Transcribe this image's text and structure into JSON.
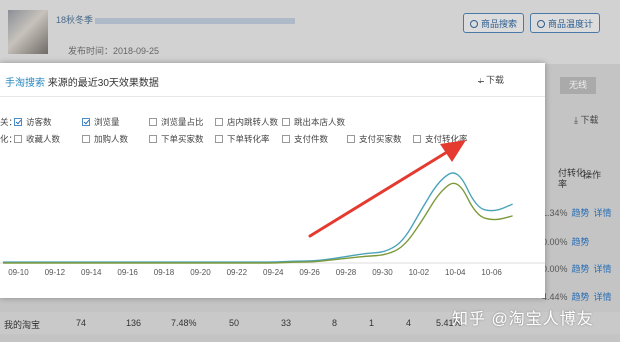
{
  "page": {
    "item_title": "18秋冬季",
    "publish_label": "发布时间：2018-09-25",
    "buttons": {
      "product_search": "商品搜索",
      "product_warmup": "商品温度计"
    },
    "wireless": "无线",
    "download": "下载",
    "table_header_right": "付转化\n率",
    "table_header_op": "操作",
    "rows": [
      {
        "value": "1.34%",
        "trend": "趋势",
        "detail": "详情"
      },
      {
        "value": "0.00%",
        "trend": "趋势",
        "detail": ""
      },
      {
        "value": "0.00%",
        "trend": "趋势",
        "detail": "详情"
      },
      {
        "value": "4.44%",
        "trend": "趋势",
        "detail": "详情"
      }
    ],
    "bottom_row": [
      "我的淘宝",
      "74",
      "136",
      "7.48%",
      "50",
      "33",
      "8",
      "1",
      "4",
      "5.41%"
    ],
    "watermark": "知乎 @淘宝人博友"
  },
  "modal": {
    "title_prefix": "手淘搜索",
    "title_rest": "来源的最近30天效果数据",
    "download": "下载",
    "metrics_row1_label": "关：",
    "metrics_row1": [
      {
        "label": "访客数",
        "checked": true
      },
      {
        "label": "浏览量",
        "checked": true
      },
      {
        "label": "浏览量占比",
        "checked": false
      },
      {
        "label": "店内跳转人数",
        "checked": false
      },
      {
        "label": "跳出本店人数",
        "checked": false
      }
    ],
    "metrics_row2_label": "化：",
    "metrics_row2": [
      {
        "label": "收藏人数",
        "checked": false
      },
      {
        "label": "加购人数",
        "checked": false
      },
      {
        "label": "下单买家数",
        "checked": false
      },
      {
        "label": "下单转化率",
        "checked": false
      },
      {
        "label": "支付件数",
        "checked": false
      },
      {
        "label": "支付买家数",
        "checked": false
      },
      {
        "label": "支付转化率",
        "checked": false
      }
    ]
  },
  "chart_data": {
    "type": "line",
    "x": [
      "09-09",
      "09-10",
      "09-11",
      "09-12",
      "09-13",
      "09-14",
      "09-15",
      "09-16",
      "09-17",
      "09-18",
      "09-19",
      "09-20",
      "09-21",
      "09-22",
      "09-23",
      "09-24",
      "09-25",
      "09-26",
      "09-27",
      "09-28",
      "09-29",
      "09-30",
      "10-01",
      "10-02",
      "10-03",
      "10-04",
      "10-05",
      "10-06",
      "10-07"
    ],
    "xticks": [
      "09-10",
      "09-12",
      "09-14",
      "09-16",
      "09-18",
      "09-20",
      "09-22",
      "09-24",
      "09-26",
      "09-28",
      "09-30",
      "10-02",
      "10-04",
      "10-06"
    ],
    "series": [
      {
        "color": "#4aa3b8",
        "values": [
          1,
          1,
          1,
          1,
          1,
          1,
          1,
          1,
          1,
          1,
          1,
          1,
          1,
          1,
          1,
          1,
          2,
          2,
          4,
          7,
          10,
          11,
          22,
          55,
          85,
          96,
          56,
          52,
          60
        ]
      },
      {
        "color": "#7d9a3a",
        "values": [
          0,
          0,
          0,
          0,
          0,
          0,
          0,
          0,
          0,
          0,
          0,
          0,
          0,
          0,
          0,
          0,
          1,
          1,
          3,
          5,
          7,
          8,
          16,
          42,
          73,
          86,
          48,
          43,
          48
        ]
      }
    ],
    "ylim": [
      0,
      110
    ],
    "grid": false,
    "legend": "none",
    "annotation": "red arrow pointing to 支付转化率"
  }
}
